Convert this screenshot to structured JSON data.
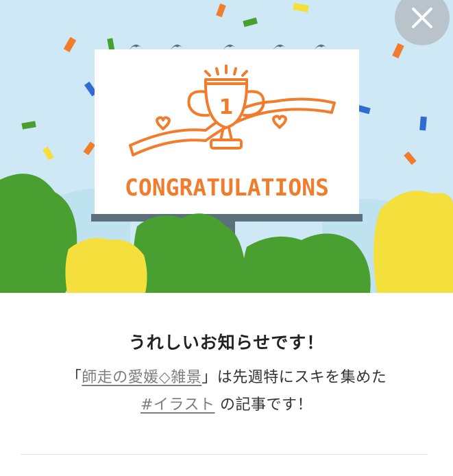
{
  "banner": {
    "billboard_text": "CONGRATULATIONS",
    "trophy_number": "1",
    "close_icon": "close-icon"
  },
  "notice": {
    "headline": "うれしいお知らせです！",
    "bracket_open": "「",
    "article_title": "師走の愛媛◇雑景",
    "bracket_close": "」",
    "message_mid": "は先週特にスキを集めた",
    "hashtag": "#イラスト",
    "message_end": "の記事です！"
  },
  "colors": {
    "sky": "#cfe8f5",
    "accent_orange": "#f07c2c",
    "tree_green": "#49a030",
    "tree_yellow": "#f5df3c",
    "close_button": "#b8c3cb"
  }
}
